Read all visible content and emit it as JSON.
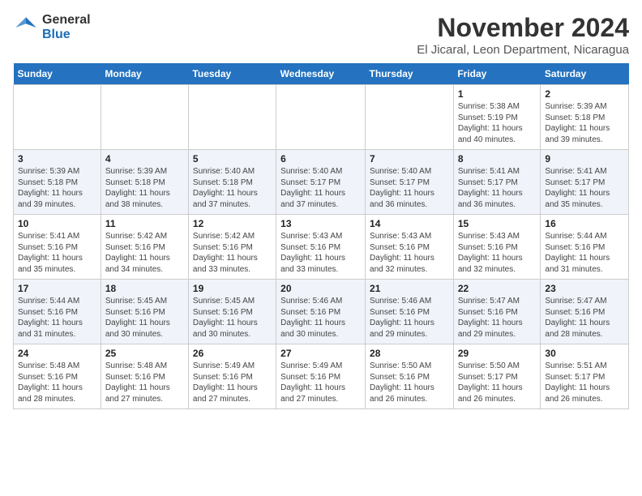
{
  "logo": {
    "general": "General",
    "blue": "Blue"
  },
  "title": "November 2024",
  "subtitle": "El Jicaral, Leon Department, Nicaragua",
  "days_of_week": [
    "Sunday",
    "Monday",
    "Tuesday",
    "Wednesday",
    "Thursday",
    "Friday",
    "Saturday"
  ],
  "weeks": [
    [
      {
        "day": "",
        "info": ""
      },
      {
        "day": "",
        "info": ""
      },
      {
        "day": "",
        "info": ""
      },
      {
        "day": "",
        "info": ""
      },
      {
        "day": "",
        "info": ""
      },
      {
        "day": "1",
        "info": "Sunrise: 5:38 AM\nSunset: 5:19 PM\nDaylight: 11 hours and 40 minutes."
      },
      {
        "day": "2",
        "info": "Sunrise: 5:39 AM\nSunset: 5:18 PM\nDaylight: 11 hours and 39 minutes."
      }
    ],
    [
      {
        "day": "3",
        "info": "Sunrise: 5:39 AM\nSunset: 5:18 PM\nDaylight: 11 hours and 39 minutes."
      },
      {
        "day": "4",
        "info": "Sunrise: 5:39 AM\nSunset: 5:18 PM\nDaylight: 11 hours and 38 minutes."
      },
      {
        "day": "5",
        "info": "Sunrise: 5:40 AM\nSunset: 5:18 PM\nDaylight: 11 hours and 37 minutes."
      },
      {
        "day": "6",
        "info": "Sunrise: 5:40 AM\nSunset: 5:17 PM\nDaylight: 11 hours and 37 minutes."
      },
      {
        "day": "7",
        "info": "Sunrise: 5:40 AM\nSunset: 5:17 PM\nDaylight: 11 hours and 36 minutes."
      },
      {
        "day": "8",
        "info": "Sunrise: 5:41 AM\nSunset: 5:17 PM\nDaylight: 11 hours and 36 minutes."
      },
      {
        "day": "9",
        "info": "Sunrise: 5:41 AM\nSunset: 5:17 PM\nDaylight: 11 hours and 35 minutes."
      }
    ],
    [
      {
        "day": "10",
        "info": "Sunrise: 5:41 AM\nSunset: 5:16 PM\nDaylight: 11 hours and 35 minutes."
      },
      {
        "day": "11",
        "info": "Sunrise: 5:42 AM\nSunset: 5:16 PM\nDaylight: 11 hours and 34 minutes."
      },
      {
        "day": "12",
        "info": "Sunrise: 5:42 AM\nSunset: 5:16 PM\nDaylight: 11 hours and 33 minutes."
      },
      {
        "day": "13",
        "info": "Sunrise: 5:43 AM\nSunset: 5:16 PM\nDaylight: 11 hours and 33 minutes."
      },
      {
        "day": "14",
        "info": "Sunrise: 5:43 AM\nSunset: 5:16 PM\nDaylight: 11 hours and 32 minutes."
      },
      {
        "day": "15",
        "info": "Sunrise: 5:43 AM\nSunset: 5:16 PM\nDaylight: 11 hours and 32 minutes."
      },
      {
        "day": "16",
        "info": "Sunrise: 5:44 AM\nSunset: 5:16 PM\nDaylight: 11 hours and 31 minutes."
      }
    ],
    [
      {
        "day": "17",
        "info": "Sunrise: 5:44 AM\nSunset: 5:16 PM\nDaylight: 11 hours and 31 minutes."
      },
      {
        "day": "18",
        "info": "Sunrise: 5:45 AM\nSunset: 5:16 PM\nDaylight: 11 hours and 30 minutes."
      },
      {
        "day": "19",
        "info": "Sunrise: 5:45 AM\nSunset: 5:16 PM\nDaylight: 11 hours and 30 minutes."
      },
      {
        "day": "20",
        "info": "Sunrise: 5:46 AM\nSunset: 5:16 PM\nDaylight: 11 hours and 30 minutes."
      },
      {
        "day": "21",
        "info": "Sunrise: 5:46 AM\nSunset: 5:16 PM\nDaylight: 11 hours and 29 minutes."
      },
      {
        "day": "22",
        "info": "Sunrise: 5:47 AM\nSunset: 5:16 PM\nDaylight: 11 hours and 29 minutes."
      },
      {
        "day": "23",
        "info": "Sunrise: 5:47 AM\nSunset: 5:16 PM\nDaylight: 11 hours and 28 minutes."
      }
    ],
    [
      {
        "day": "24",
        "info": "Sunrise: 5:48 AM\nSunset: 5:16 PM\nDaylight: 11 hours and 28 minutes."
      },
      {
        "day": "25",
        "info": "Sunrise: 5:48 AM\nSunset: 5:16 PM\nDaylight: 11 hours and 27 minutes."
      },
      {
        "day": "26",
        "info": "Sunrise: 5:49 AM\nSunset: 5:16 PM\nDaylight: 11 hours and 27 minutes."
      },
      {
        "day": "27",
        "info": "Sunrise: 5:49 AM\nSunset: 5:16 PM\nDaylight: 11 hours and 27 minutes."
      },
      {
        "day": "28",
        "info": "Sunrise: 5:50 AM\nSunset: 5:16 PM\nDaylight: 11 hours and 26 minutes."
      },
      {
        "day": "29",
        "info": "Sunrise: 5:50 AM\nSunset: 5:17 PM\nDaylight: 11 hours and 26 minutes."
      },
      {
        "day": "30",
        "info": "Sunrise: 5:51 AM\nSunset: 5:17 PM\nDaylight: 11 hours and 26 minutes."
      }
    ]
  ]
}
